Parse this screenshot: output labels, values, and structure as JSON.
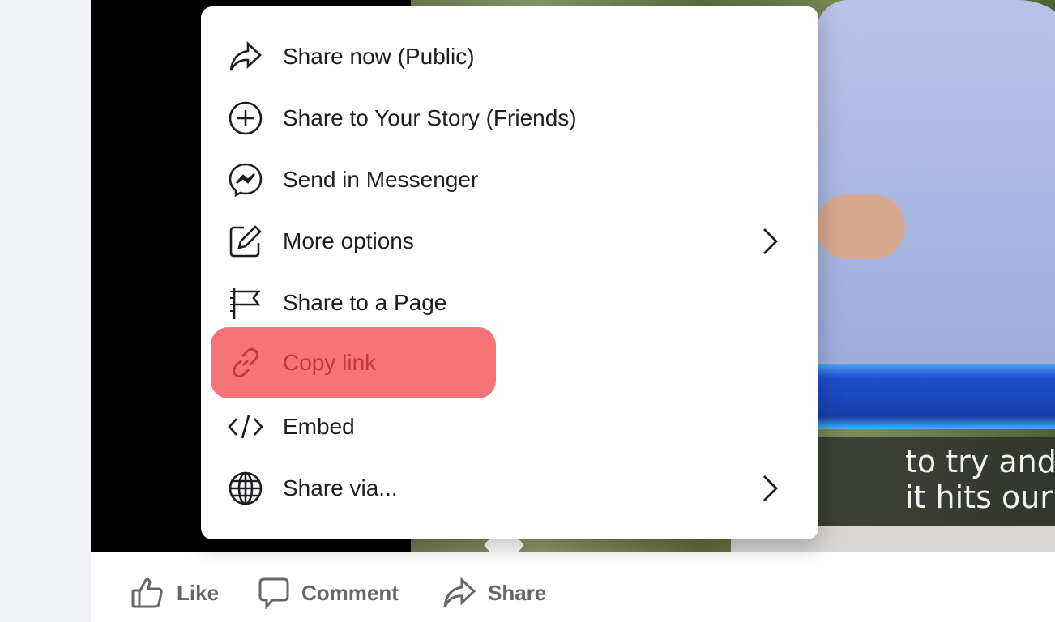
{
  "menu": {
    "items": [
      {
        "label": "Share now (Public)",
        "icon": "share-arrow-icon"
      },
      {
        "label": "Share to Your Story (Friends)",
        "icon": "plus-circle-icon"
      },
      {
        "label": "Send in Messenger",
        "icon": "messenger-icon"
      },
      {
        "label": "More options",
        "icon": "edit-icon",
        "submenu": true
      },
      {
        "label": "Share to a Page",
        "icon": "flag-icon"
      },
      {
        "label": "Copy link",
        "icon": "link-icon",
        "highlighted": true
      },
      {
        "label": "Embed",
        "icon": "code-icon"
      },
      {
        "label": "Share via...",
        "icon": "globe-icon",
        "submenu": true
      }
    ]
  },
  "video": {
    "subtitle_line1": "to try and stop",
    "subtitle_line2": "it hits our defe"
  },
  "actions": {
    "like": "Like",
    "comment": "Comment",
    "share": "Share"
  },
  "colors": {
    "highlight": "#f57577",
    "highlight_text": "#c2393b",
    "action_text": "#65676b"
  }
}
